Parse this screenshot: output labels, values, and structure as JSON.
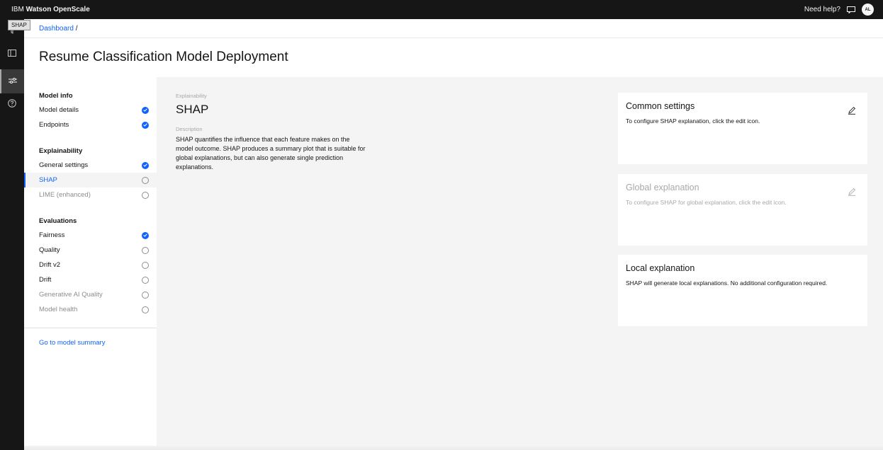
{
  "app": {
    "brand_prefix": "IBM",
    "brand_name": "Watson OpenScale"
  },
  "topbar": {
    "help_label": "Need help?",
    "avatar_initials": "AL"
  },
  "rail": {
    "tooltip": "SHAP"
  },
  "breadcrumb": {
    "dashboard": "Dashboard",
    "separator": "/"
  },
  "page": {
    "title": "Resume Classification Model Deployment"
  },
  "sidenav": {
    "sections": {
      "model_info": "Model info",
      "explainability": "Explainability",
      "evaluations": "Evaluations"
    },
    "items": [
      {
        "label": "Model details",
        "status": "done"
      },
      {
        "label": "Endpoints",
        "status": "done"
      },
      {
        "label": "General settings",
        "status": "done"
      },
      {
        "label": "SHAP",
        "status": "pending"
      },
      {
        "label": "LIME (enhanced)",
        "status": "pending"
      },
      {
        "label": "Fairness",
        "status": "done"
      },
      {
        "label": "Quality",
        "status": "pending"
      },
      {
        "label": "Drift v2",
        "status": "pending"
      },
      {
        "label": "Drift",
        "status": "pending"
      },
      {
        "label": "Generative AI Quality",
        "status": "pending"
      },
      {
        "label": "Model health",
        "status": "pending"
      }
    ],
    "summary_link": "Go to model summary"
  },
  "main": {
    "category": "Explainability",
    "heading": "SHAP",
    "description_label": "Description",
    "description": "SHAP quantifies the influence that each feature makes on the model outcome. SHAP produces a summary plot that is suitable for global explanations, but can also generate single prediction explanations."
  },
  "cards": [
    {
      "title": "Common settings",
      "text": "To configure SHAP explanation, click the edit icon."
    },
    {
      "title": "Global explanation",
      "text": "To configure SHAP for global explanation, click the edit icon."
    },
    {
      "title": "Local explanation",
      "text": "SHAP will generate local explanations. No additional configuration required."
    }
  ],
  "colors": {
    "accent": "#0f62fe",
    "topbar": "#161616",
    "content_bg": "#f4f4f4"
  }
}
